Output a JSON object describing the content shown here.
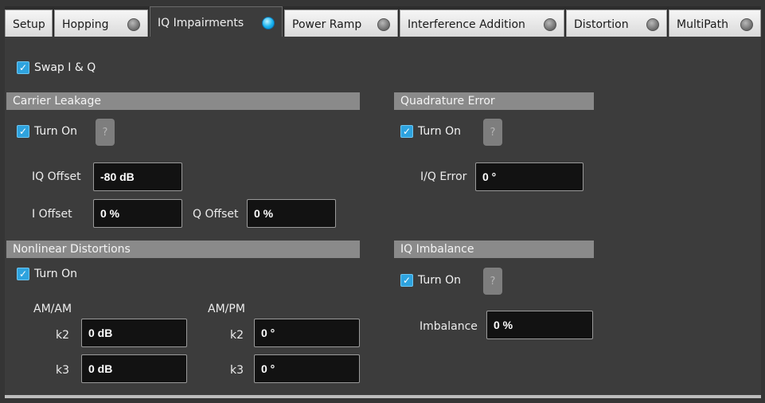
{
  "tabs": [
    {
      "label": "Setup",
      "indicator": null
    },
    {
      "label": "Hopping",
      "indicator": "off"
    },
    {
      "label": "IQ Impairments",
      "indicator": "on"
    },
    {
      "label": "Power Ramp",
      "indicator": "off"
    },
    {
      "label": "Interference Addition",
      "indicator": "off"
    },
    {
      "label": "Distortion",
      "indicator": "off"
    },
    {
      "label": "MultiPath",
      "indicator": "off"
    }
  ],
  "swap": {
    "label": "Swap I & Q",
    "checked": true
  },
  "carrier_leakage": {
    "title": "Carrier Leakage",
    "turn_on": "Turn On",
    "help": "?",
    "iq_offset_label": "IQ Offset",
    "iq_offset_value": "-80 dB",
    "i_offset_label": "I Offset",
    "i_offset_value": "0 %",
    "q_offset_label": "Q Offset",
    "q_offset_value": "0 %"
  },
  "quadrature_error": {
    "title": "Quadrature Error",
    "turn_on": "Turn On",
    "help": "?",
    "iq_error_label": "I/Q Error",
    "iq_error_value": "0 °"
  },
  "nonlinear": {
    "title": "Nonlinear Distortions",
    "turn_on": "Turn On",
    "amam_label": "AM/AM",
    "ampm_label": "AM/PM",
    "k2_label": "k2",
    "k3_label": "k3",
    "amam_k2": "0 dB",
    "amam_k3": "0 dB",
    "ampm_k2": "0 °",
    "ampm_k3": "0 °"
  },
  "iq_imbalance": {
    "title": "IQ Imbalance",
    "turn_on": "Turn On",
    "help": "?",
    "imbalance_label": "Imbalance",
    "imbalance_value": "0 %"
  },
  "colors": {
    "active_indicator": "#17b2ee",
    "checkbox": "#2ea3df",
    "section_header": "#8a8a8a",
    "background": "#3c3c3c"
  },
  "icons": {
    "check": "checkmark-icon",
    "help": "question-icon"
  }
}
